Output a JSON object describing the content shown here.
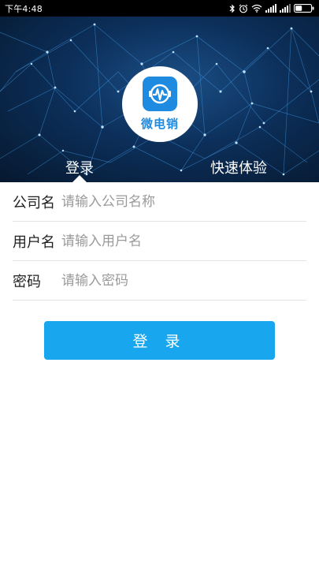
{
  "status_bar": {
    "time": "下午4:48",
    "icons": [
      "bluetooth-icon",
      "alarm-icon",
      "wifi-icon",
      "signal-icon",
      "signal-icon",
      "battery-icon"
    ]
  },
  "app": {
    "logo_text": "微电销",
    "brand_color": "#1e8be0"
  },
  "tabs": {
    "login": "登录",
    "quick_experience": "快速体验"
  },
  "form": {
    "company": {
      "label": "公司名",
      "placeholder": "请输入公司名称",
      "value": ""
    },
    "username": {
      "label": "用户名",
      "placeholder": "请输入用户名",
      "value": ""
    },
    "password": {
      "label": "密码",
      "placeholder": "请输入密码",
      "value": ""
    }
  },
  "login_button": {
    "label": "登 录",
    "color": "#18a7ee"
  }
}
